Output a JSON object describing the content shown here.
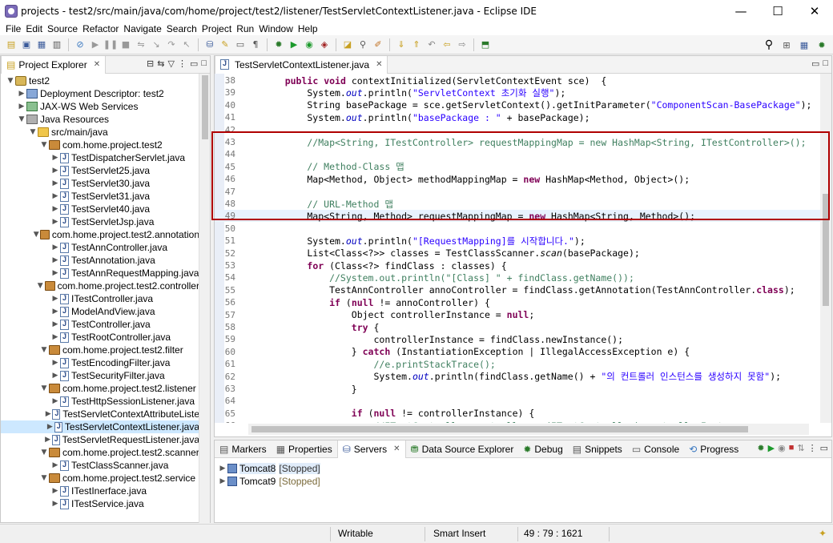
{
  "window": {
    "title": "projects - test2/src/main/java/com/home/project/test2/listener/TestServletContextListener.java - Eclipse IDE",
    "minimize": "—",
    "maximize": "☐",
    "close": "✕"
  },
  "menu": [
    "File",
    "Edit",
    "Source",
    "Refactor",
    "Navigate",
    "Search",
    "Project",
    "Run",
    "Window",
    "Help"
  ],
  "explorer": {
    "tab_label": "Project Explorer",
    "tree": [
      {
        "label": "test2",
        "depth": 0,
        "icon": "project",
        "twisty": "open"
      },
      {
        "label": "Deployment Descriptor: test2",
        "depth": 1,
        "icon": "dd",
        "twisty": "closed"
      },
      {
        "label": "JAX-WS Web Services",
        "depth": 1,
        "icon": "ws",
        "twisty": "closed"
      },
      {
        "label": "Java Resources",
        "depth": 1,
        "icon": "lib",
        "twisty": "open"
      },
      {
        "label": "src/main/java",
        "depth": 2,
        "icon": "folder",
        "twisty": "open"
      },
      {
        "label": "com.home.project.test2",
        "depth": 3,
        "icon": "pkg",
        "twisty": "open"
      },
      {
        "label": "TestDispatcherServlet.java",
        "depth": 4,
        "icon": "java",
        "twisty": "closed"
      },
      {
        "label": "TestServlet25.java",
        "depth": 4,
        "icon": "java",
        "twisty": "closed"
      },
      {
        "label": "TestServlet30.java",
        "depth": 4,
        "icon": "java",
        "twisty": "closed"
      },
      {
        "label": "TestServlet31.java",
        "depth": 4,
        "icon": "java",
        "twisty": "closed"
      },
      {
        "label": "TestServlet40.java",
        "depth": 4,
        "icon": "java",
        "twisty": "closed"
      },
      {
        "label": "TestServletJsp.java",
        "depth": 4,
        "icon": "java",
        "twisty": "closed"
      },
      {
        "label": "com.home.project.test2.annotation",
        "depth": 3,
        "icon": "pkg",
        "twisty": "open"
      },
      {
        "label": "TestAnnController.java",
        "depth": 4,
        "icon": "java",
        "twisty": "closed"
      },
      {
        "label": "TestAnnotation.java",
        "depth": 4,
        "icon": "java",
        "twisty": "closed"
      },
      {
        "label": "TestAnnRequestMapping.java",
        "depth": 4,
        "icon": "java",
        "twisty": "closed"
      },
      {
        "label": "com.home.project.test2.controller",
        "depth": 3,
        "icon": "pkg",
        "twisty": "open"
      },
      {
        "label": "ITestController.java",
        "depth": 4,
        "icon": "java",
        "twisty": "closed"
      },
      {
        "label": "ModelAndView.java",
        "depth": 4,
        "icon": "java",
        "twisty": "closed"
      },
      {
        "label": "TestController.java",
        "depth": 4,
        "icon": "java",
        "twisty": "closed"
      },
      {
        "label": "TestRootController.java",
        "depth": 4,
        "icon": "java",
        "twisty": "closed"
      },
      {
        "label": "com.home.project.test2.filter",
        "depth": 3,
        "icon": "pkg",
        "twisty": "open"
      },
      {
        "label": "TestEncodingFilter.java",
        "depth": 4,
        "icon": "java",
        "twisty": "closed"
      },
      {
        "label": "TestSecurityFilter.java",
        "depth": 4,
        "icon": "java",
        "twisty": "closed"
      },
      {
        "label": "com.home.project.test2.listener",
        "depth": 3,
        "icon": "pkg",
        "twisty": "open"
      },
      {
        "label": "TestHttpSessionListener.java",
        "depth": 4,
        "icon": "java",
        "twisty": "closed"
      },
      {
        "label": "TestServletContextAttributeListe",
        "depth": 4,
        "icon": "java",
        "twisty": "closed"
      },
      {
        "label": "TestServletContextListener.java",
        "depth": 4,
        "icon": "java",
        "twisty": "closed",
        "selected": true
      },
      {
        "label": "TestServletRequestListener.java",
        "depth": 4,
        "icon": "java",
        "twisty": "closed"
      },
      {
        "label": "com.home.project.test2.scanner",
        "depth": 3,
        "icon": "pkg",
        "twisty": "open"
      },
      {
        "label": "TestClassScanner.java",
        "depth": 4,
        "icon": "java",
        "twisty": "closed"
      },
      {
        "label": "com.home.project.test2.service",
        "depth": 3,
        "icon": "pkg",
        "twisty": "open"
      },
      {
        "label": "ITestInerface.java",
        "depth": 4,
        "icon": "java",
        "twisty": "closed"
      },
      {
        "label": "ITestService.java",
        "depth": 4,
        "icon": "java",
        "twisty": "closed"
      }
    ]
  },
  "editor": {
    "tab_label": "TestServletContextListener.java",
    "current_line": "49",
    "lines": [
      {
        "n": "38",
        "tokens": [
          [
            "",
            "    "
          ],
          [
            "kw",
            "public"
          ],
          [
            "",
            " "
          ],
          [
            "kw",
            "void"
          ],
          [
            "",
            " contextInitialized(ServletContextEvent sce)  {"
          ]
        ]
      },
      {
        "n": "39",
        "tokens": [
          [
            "",
            "        System."
          ],
          [
            "fld",
            "out"
          ],
          [
            "",
            ".println("
          ],
          [
            "str",
            "\"ServletContext 초기화 실행\""
          ],
          [
            "",
            ");"
          ]
        ]
      },
      {
        "n": "40",
        "tokens": [
          [
            "",
            "        String basePackage = sce.getServletContext().getInitParameter("
          ],
          [
            "str",
            "\"ComponentScan-BasePackage\""
          ],
          [
            "",
            ");"
          ]
        ]
      },
      {
        "n": "41",
        "tokens": [
          [
            "",
            "        System."
          ],
          [
            "fld",
            "out"
          ],
          [
            "",
            ".println("
          ],
          [
            "str",
            "\"basePackage : \""
          ],
          [
            "",
            " + basePackage);"
          ]
        ]
      },
      {
        "n": "42",
        "tokens": [
          [
            "",
            ""
          ]
        ]
      },
      {
        "n": "43",
        "tokens": [
          [
            "cmt",
            "        //Map<String, ITestController> requestMappingMap = new HashMap<String, ITestController>();"
          ]
        ]
      },
      {
        "n": "44",
        "tokens": [
          [
            "",
            ""
          ]
        ]
      },
      {
        "n": "45",
        "tokens": [
          [
            "cmt",
            "        // Method-Class 맵"
          ]
        ]
      },
      {
        "n": "46",
        "tokens": [
          [
            "",
            "        Map<Method, Object> methodMappingMap = "
          ],
          [
            "kw",
            "new"
          ],
          [
            "",
            " HashMap<Method, Object>();"
          ]
        ]
      },
      {
        "n": "47",
        "tokens": [
          [
            "",
            ""
          ]
        ]
      },
      {
        "n": "48",
        "tokens": [
          [
            "cmt",
            "        // URL-Method 맵"
          ]
        ]
      },
      {
        "n": "49",
        "tokens": [
          [
            "",
            "        Map<String, Method> requestMappingMap = "
          ],
          [
            "kw",
            "new"
          ],
          [
            "",
            " HashMap<String, Method>();"
          ]
        ]
      },
      {
        "n": "50",
        "tokens": [
          [
            "",
            ""
          ]
        ]
      },
      {
        "n": "51",
        "tokens": [
          [
            "",
            "        System."
          ],
          [
            "fld",
            "out"
          ],
          [
            "",
            ".println("
          ],
          [
            "str",
            "\"[RequestMapping]를 시작합니다.\""
          ],
          [
            "",
            ");"
          ]
        ]
      },
      {
        "n": "52",
        "tokens": [
          [
            "",
            "        List<Class<?>> classes = TestClassScanner."
          ],
          [
            "ital",
            "scan"
          ],
          [
            "",
            "(basePackage);"
          ]
        ]
      },
      {
        "n": "53",
        "tokens": [
          [
            "",
            "        "
          ],
          [
            "kw",
            "for"
          ],
          [
            "",
            " (Class<?> findClass : classes) {"
          ]
        ]
      },
      {
        "n": "54",
        "tokens": [
          [
            "cmt",
            "            //System.out.println(\"[Class] \" + findClass.getName());"
          ]
        ]
      },
      {
        "n": "55",
        "tokens": [
          [
            "",
            "            TestAnnController annoController = findClass.getAnnotation(TestAnnController."
          ],
          [
            "kw",
            "class"
          ],
          [
            "",
            ");"
          ]
        ]
      },
      {
        "n": "56",
        "tokens": [
          [
            "",
            "            "
          ],
          [
            "kw",
            "if"
          ],
          [
            "",
            " ("
          ],
          [
            "kw",
            "null"
          ],
          [
            "",
            " != annoController) {"
          ]
        ]
      },
      {
        "n": "57",
        "tokens": [
          [
            "",
            "                Object controllerInstance = "
          ],
          [
            "kw",
            "null"
          ],
          [
            "",
            ";"
          ]
        ]
      },
      {
        "n": "58",
        "tokens": [
          [
            "",
            "                "
          ],
          [
            "kw",
            "try"
          ],
          [
            "",
            " {"
          ]
        ]
      },
      {
        "n": "59",
        "tokens": [
          [
            "",
            "                    controllerInstance = findClass.newInstance();"
          ]
        ]
      },
      {
        "n": "60",
        "tokens": [
          [
            "",
            "                } "
          ],
          [
            "kw",
            "catch"
          ],
          [
            "",
            " (InstantiationException | IllegalAccessException e) {"
          ]
        ]
      },
      {
        "n": "61",
        "tokens": [
          [
            "cmt",
            "                    //e.printStackTrace();"
          ]
        ]
      },
      {
        "n": "62",
        "tokens": [
          [
            "",
            "                    System."
          ],
          [
            "fld",
            "out"
          ],
          [
            "",
            ".println(findClass.getName() + "
          ],
          [
            "str",
            "\"의 컨트롤러 인스턴스를 생성하지 못함\""
          ],
          [
            "",
            ");"
          ]
        ]
      },
      {
        "n": "63",
        "tokens": [
          [
            "",
            "                }"
          ]
        ]
      },
      {
        "n": "64",
        "tokens": [
          [
            "",
            ""
          ]
        ]
      },
      {
        "n": "65",
        "tokens": [
          [
            "",
            "                "
          ],
          [
            "kw",
            "if"
          ],
          [
            "",
            " ("
          ],
          [
            "kw",
            "null"
          ],
          [
            "",
            " != controllerInstance) {"
          ]
        ]
      },
      {
        "n": "66",
        "tokens": [
          [
            "cmt",
            "                    //ITestController controller = (ITestController) controllerInstance;"
          ]
        ]
      }
    ]
  },
  "bottom_panel": {
    "tabs": [
      "Markers",
      "Properties",
      "Servers",
      "Data Source Explorer",
      "Debug",
      "Snippets",
      "Console",
      "Progress"
    ],
    "active_tab": "Servers",
    "servers": [
      {
        "name": "Tomcat8",
        "state": "[Stopped]"
      },
      {
        "name": "Tomcat9",
        "state": "[Stopped]"
      }
    ]
  },
  "status": {
    "mode": "Writable",
    "insert": "Smart Insert",
    "position": "49 : 79 : 1621"
  }
}
